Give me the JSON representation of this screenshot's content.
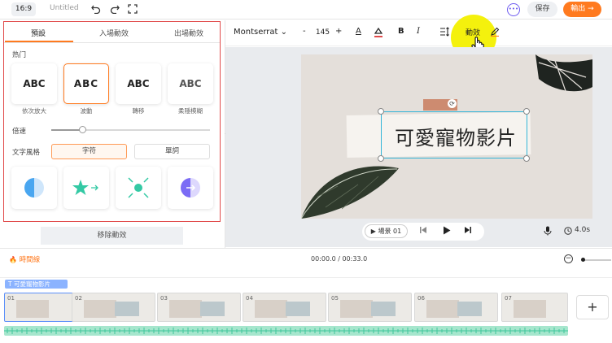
{
  "topbar": {
    "ratio": "16:9",
    "title": "Untitled",
    "save": "保存",
    "export": "輸出 →",
    "icons": [
      "undo-icon",
      "redo-icon",
      "fullscreen-icon",
      "chat-icon"
    ]
  },
  "left_panel": {
    "tabs": [
      "預設",
      "入場動效",
      "出場動效"
    ],
    "section_hot": "热门",
    "animations": [
      {
        "sample": "ABC",
        "name": "依次放大"
      },
      {
        "sample": "ABC",
        "name": "波動"
      },
      {
        "sample": "ABC",
        "name": "轉移"
      },
      {
        "sample": "ABC",
        "name": "柔隱模糊"
      }
    ],
    "speed_label": "倍速",
    "speed_level": 0.2,
    "style_label": "文字風格",
    "style_options": [
      "字符",
      "單詞"
    ],
    "remove_button": "移除動效"
  },
  "format_bar": {
    "font": "Montserrat",
    "font_size": "145",
    "minus": "-",
    "plus": "+",
    "bold": "B",
    "italic": "I",
    "animation_label": "動效"
  },
  "canvas": {
    "text": "可愛寵物影片"
  },
  "playback": {
    "scene": "▶ 場景 01",
    "duration": "4.0s"
  },
  "timeline": {
    "tag": "時間線",
    "time": "00:00.0 / 00:33.0",
    "text_track": "可愛寵物影片",
    "clips": [
      "01",
      "02",
      "03",
      "04",
      "05",
      "06",
      "07"
    ],
    "add": "+"
  },
  "colors": {
    "accent": "#ff7a1f",
    "selection": "#33b5d8",
    "highlight": "#f3f000",
    "frame": "#e14a4a"
  }
}
